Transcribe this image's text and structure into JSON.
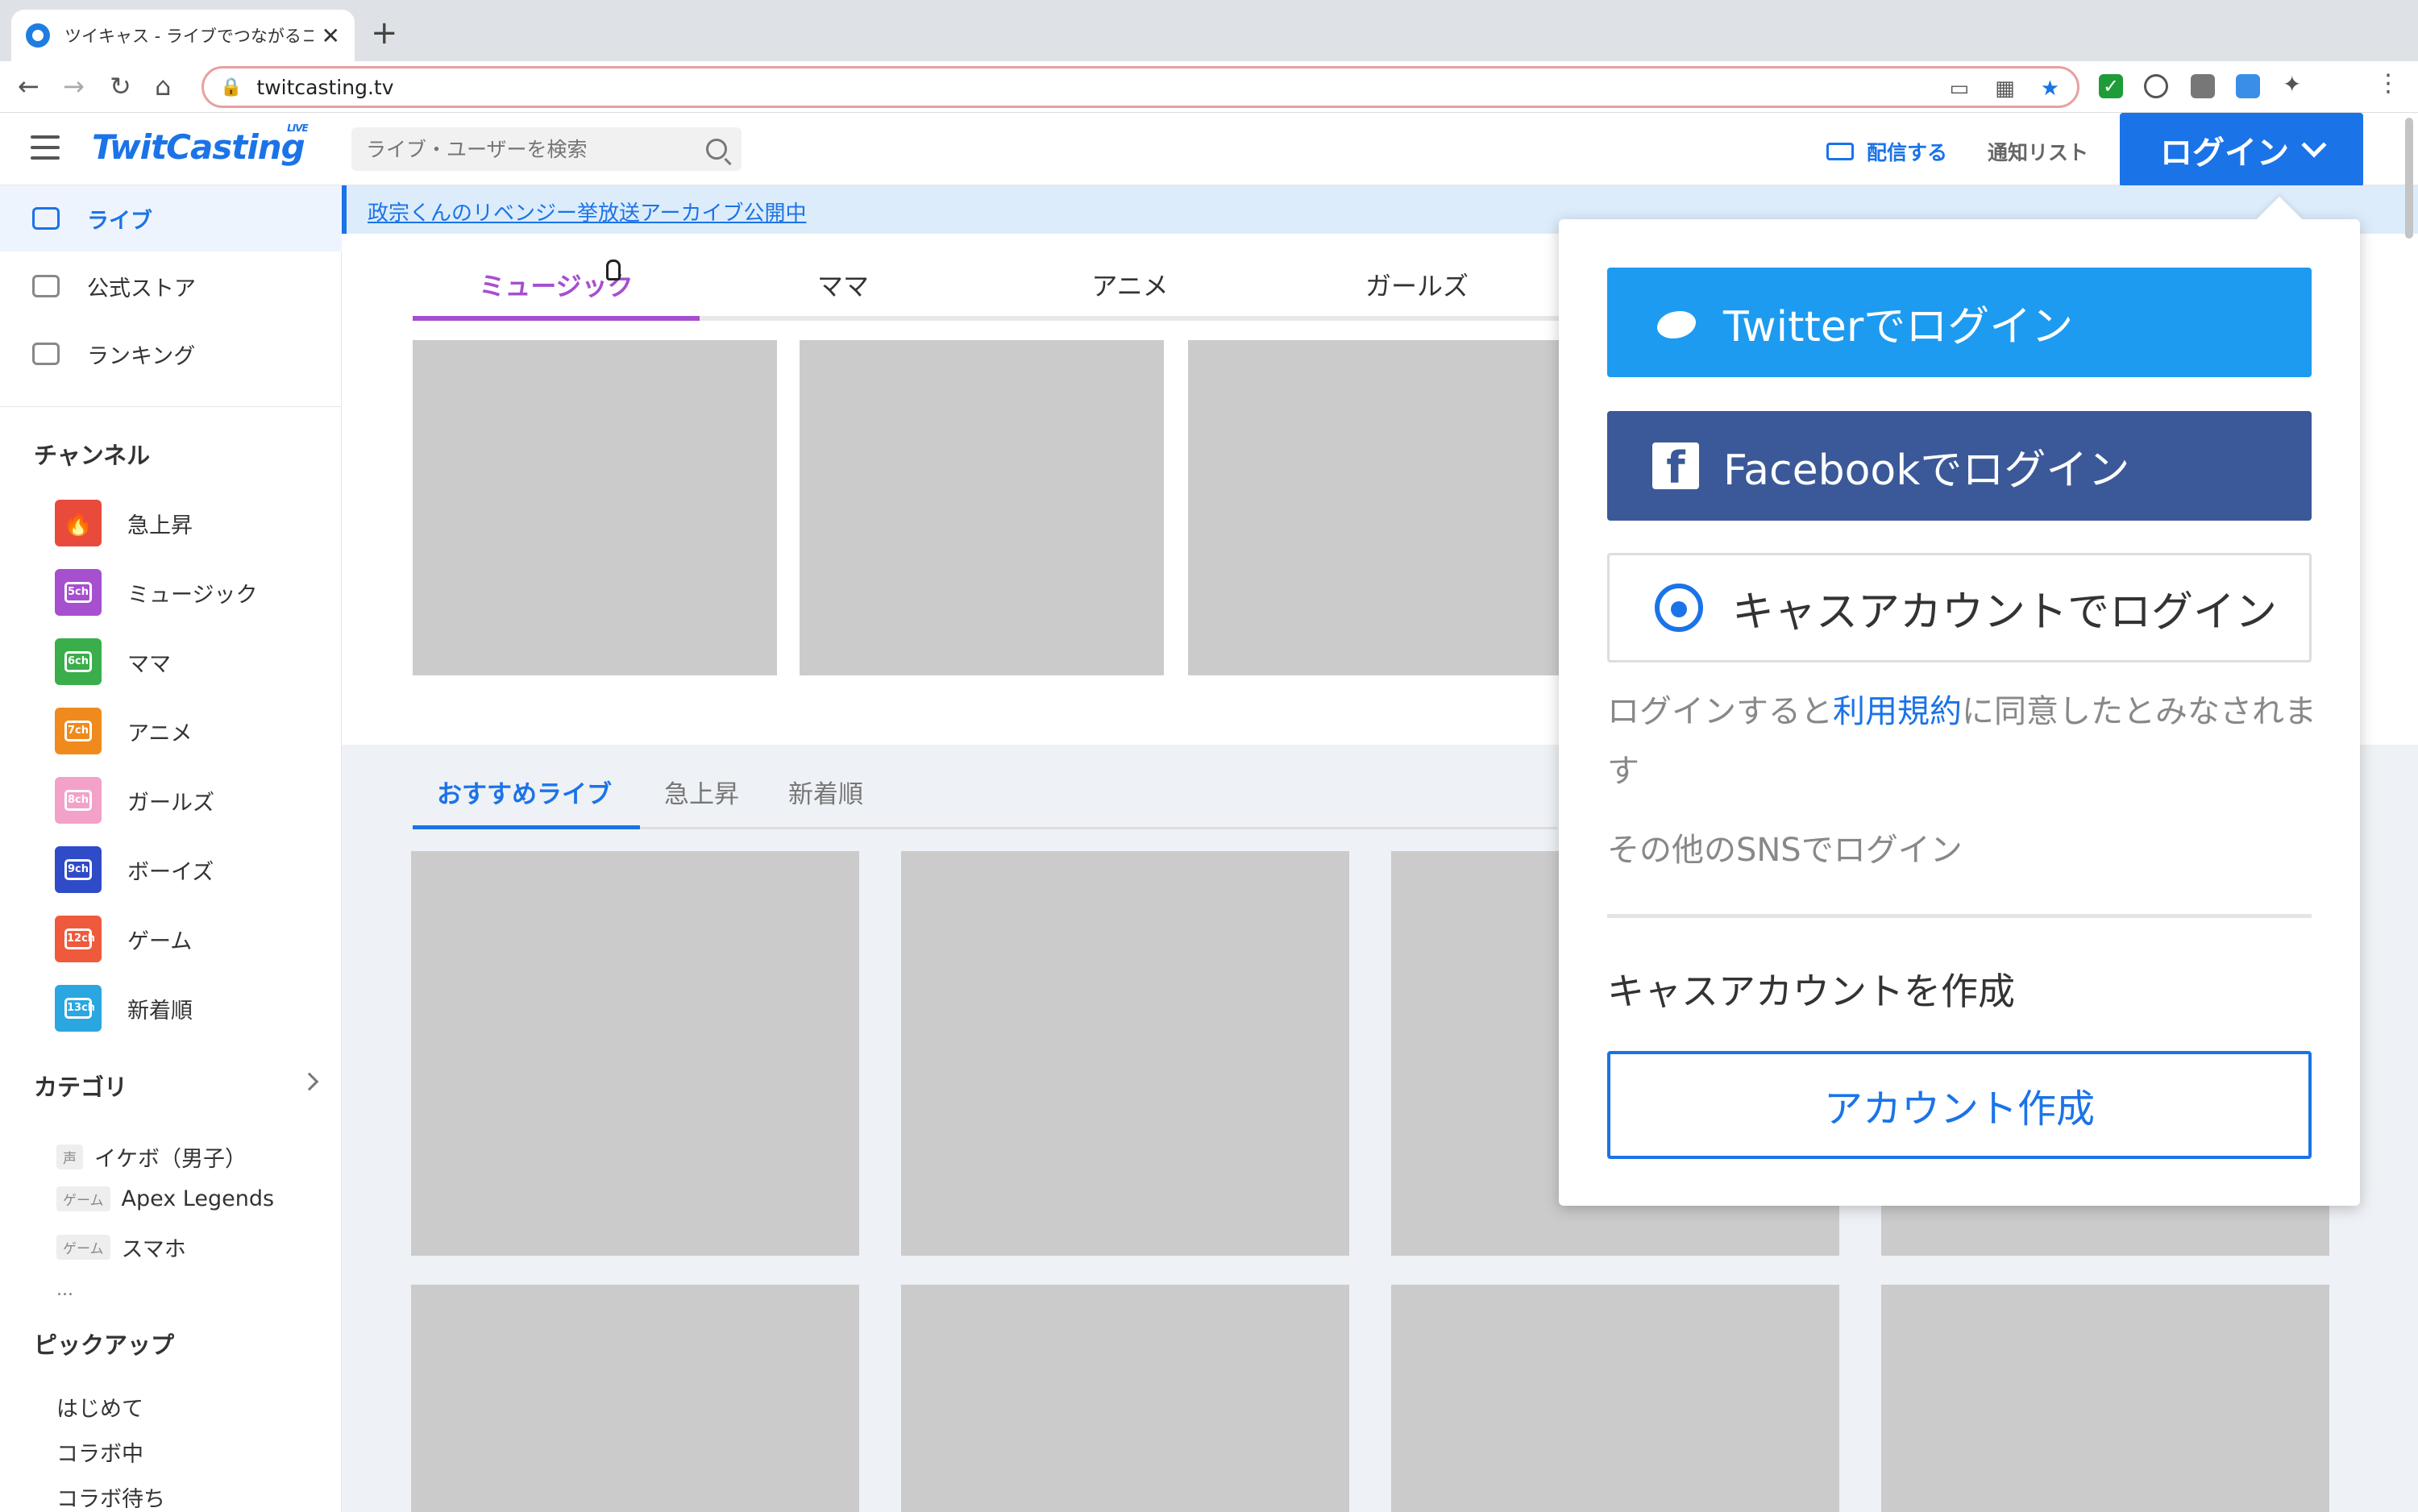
{
  "browser": {
    "tab_title": "ツイキャス - ライブでつながるコミュニティ",
    "new_tab": "+",
    "close_tab": "✕",
    "url": "twitcasting.tv",
    "back": "←",
    "forward": "→",
    "reload": "↻",
    "home": "⌂"
  },
  "header": {
    "logo": "TwitCasting",
    "logo_badge": "LIVE",
    "search_placeholder": "ライブ・ユーザーを検索",
    "broadcast": "配信する",
    "notify_list": "通知リスト",
    "login": "ログイン"
  },
  "sidebar": {
    "nav": [
      {
        "label": "ライブ",
        "icon": "tv-icon"
      },
      {
        "label": "公式ストア",
        "icon": "store-icon"
      },
      {
        "label": "ランキング",
        "icon": "crown-icon"
      }
    ],
    "channel_heading": "チャンネル",
    "channels": [
      {
        "label": "急上昇",
        "badge": "🔥",
        "color": "#e84b3c"
      },
      {
        "label": "ミュージック",
        "badge": "5ch",
        "color": "#a64fcf"
      },
      {
        "label": "ママ",
        "badge": "6ch",
        "color": "#3aae4a"
      },
      {
        "label": "アニメ",
        "badge": "7ch",
        "color": "#f08a1c"
      },
      {
        "label": "ガールズ",
        "badge": "8ch",
        "color": "#f2a2c9"
      },
      {
        "label": "ボーイズ",
        "badge": "9ch",
        "color": "#2f4bc8"
      },
      {
        "label": "ゲーム",
        "badge": "12ch",
        "color": "#ef5a3c"
      },
      {
        "label": "新着順",
        "badge": "13ch",
        "color": "#2aa6e0"
      }
    ],
    "category_heading": "カテゴリ",
    "categories": [
      {
        "tag": "声",
        "label": "イケボ（男子）"
      },
      {
        "tag": "ゲーム",
        "label": "Apex Legends"
      },
      {
        "tag": "ゲーム",
        "label": "スマホ"
      }
    ],
    "more": "...",
    "pickup_heading": "ピックアップ",
    "pickups": [
      "はじめて",
      "コラボ中",
      "コラボ待ち"
    ]
  },
  "main": {
    "banner": "政宗くんのリベンジー挙放送アーカイブ公開中",
    "channel_tabs": [
      "ミュージック",
      "ママ",
      "アニメ",
      "ガールズ"
    ],
    "rec_tabs": [
      "おすすめライブ",
      "急上昇",
      "新着順"
    ]
  },
  "dropdown": {
    "twitter": "Twitterでログイン",
    "facebook": "Facebookでログイン",
    "cas": "キャスアカウントでログイン",
    "terms_pre": "ログインすると",
    "terms_link": "利用規約",
    "terms_post": "に同意したとみなされます",
    "other_sns": "その他のSNSでログイン",
    "create_title": "キャスアカウントを作成",
    "create_button": "アカウント作成"
  },
  "colors": {
    "brand": "#1b73e8",
    "music": "#a64fcf",
    "twitter": "#1d9bf0",
    "facebook": "#3b5998"
  }
}
